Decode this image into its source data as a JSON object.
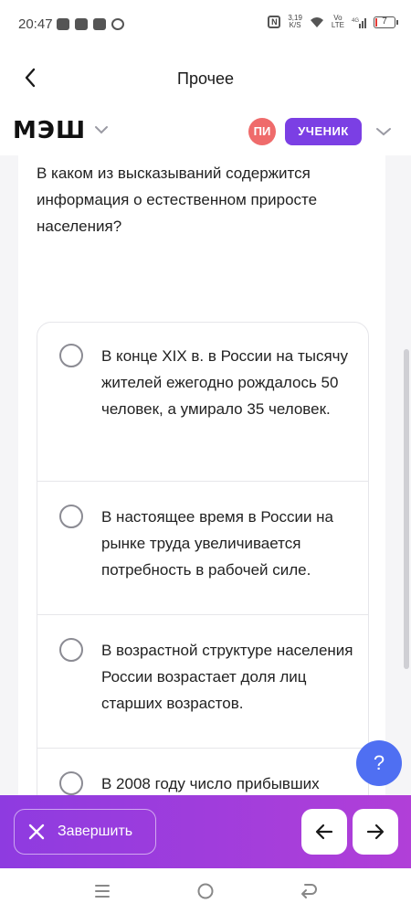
{
  "status_bar": {
    "time": "20:47",
    "network_speed": "3,19\nK/S",
    "network_type": "Vo LTE 4G",
    "battery": "7"
  },
  "header": {
    "title": "Прочее",
    "back_icon": "back-arrow-icon"
  },
  "brand": {
    "logo": "МЭШ",
    "avatar_initials": "ПИ",
    "role": "УЧЕНИК"
  },
  "question": {
    "text": "В каком из высказываний содержится информация о естественном приросте населения?"
  },
  "options": [
    {
      "text": "В  конце XIX в. в России на тысячу жителей ежегодно рождалось 50 человек, а умирало 35 человек."
    },
    {
      "text": "В настоящее время в России на рынке труда увеличивается потребность в рабочей силе."
    },
    {
      "text": "В возрастной структуре населения России возрастает доля лиц старших возрастов."
    },
    {
      "text": "В 2008 году число прибывших"
    }
  ],
  "help": {
    "label": "?"
  },
  "bottom_bar": {
    "finish_label": "Завершить",
    "colors": {
      "gradient_start": "#8e3be0",
      "gradient_end": "#b13fd8"
    }
  },
  "colors": {
    "role_badge": "#7b3fe4",
    "avatar": "#ef6b6b",
    "help_button": "#4f6ff2"
  }
}
